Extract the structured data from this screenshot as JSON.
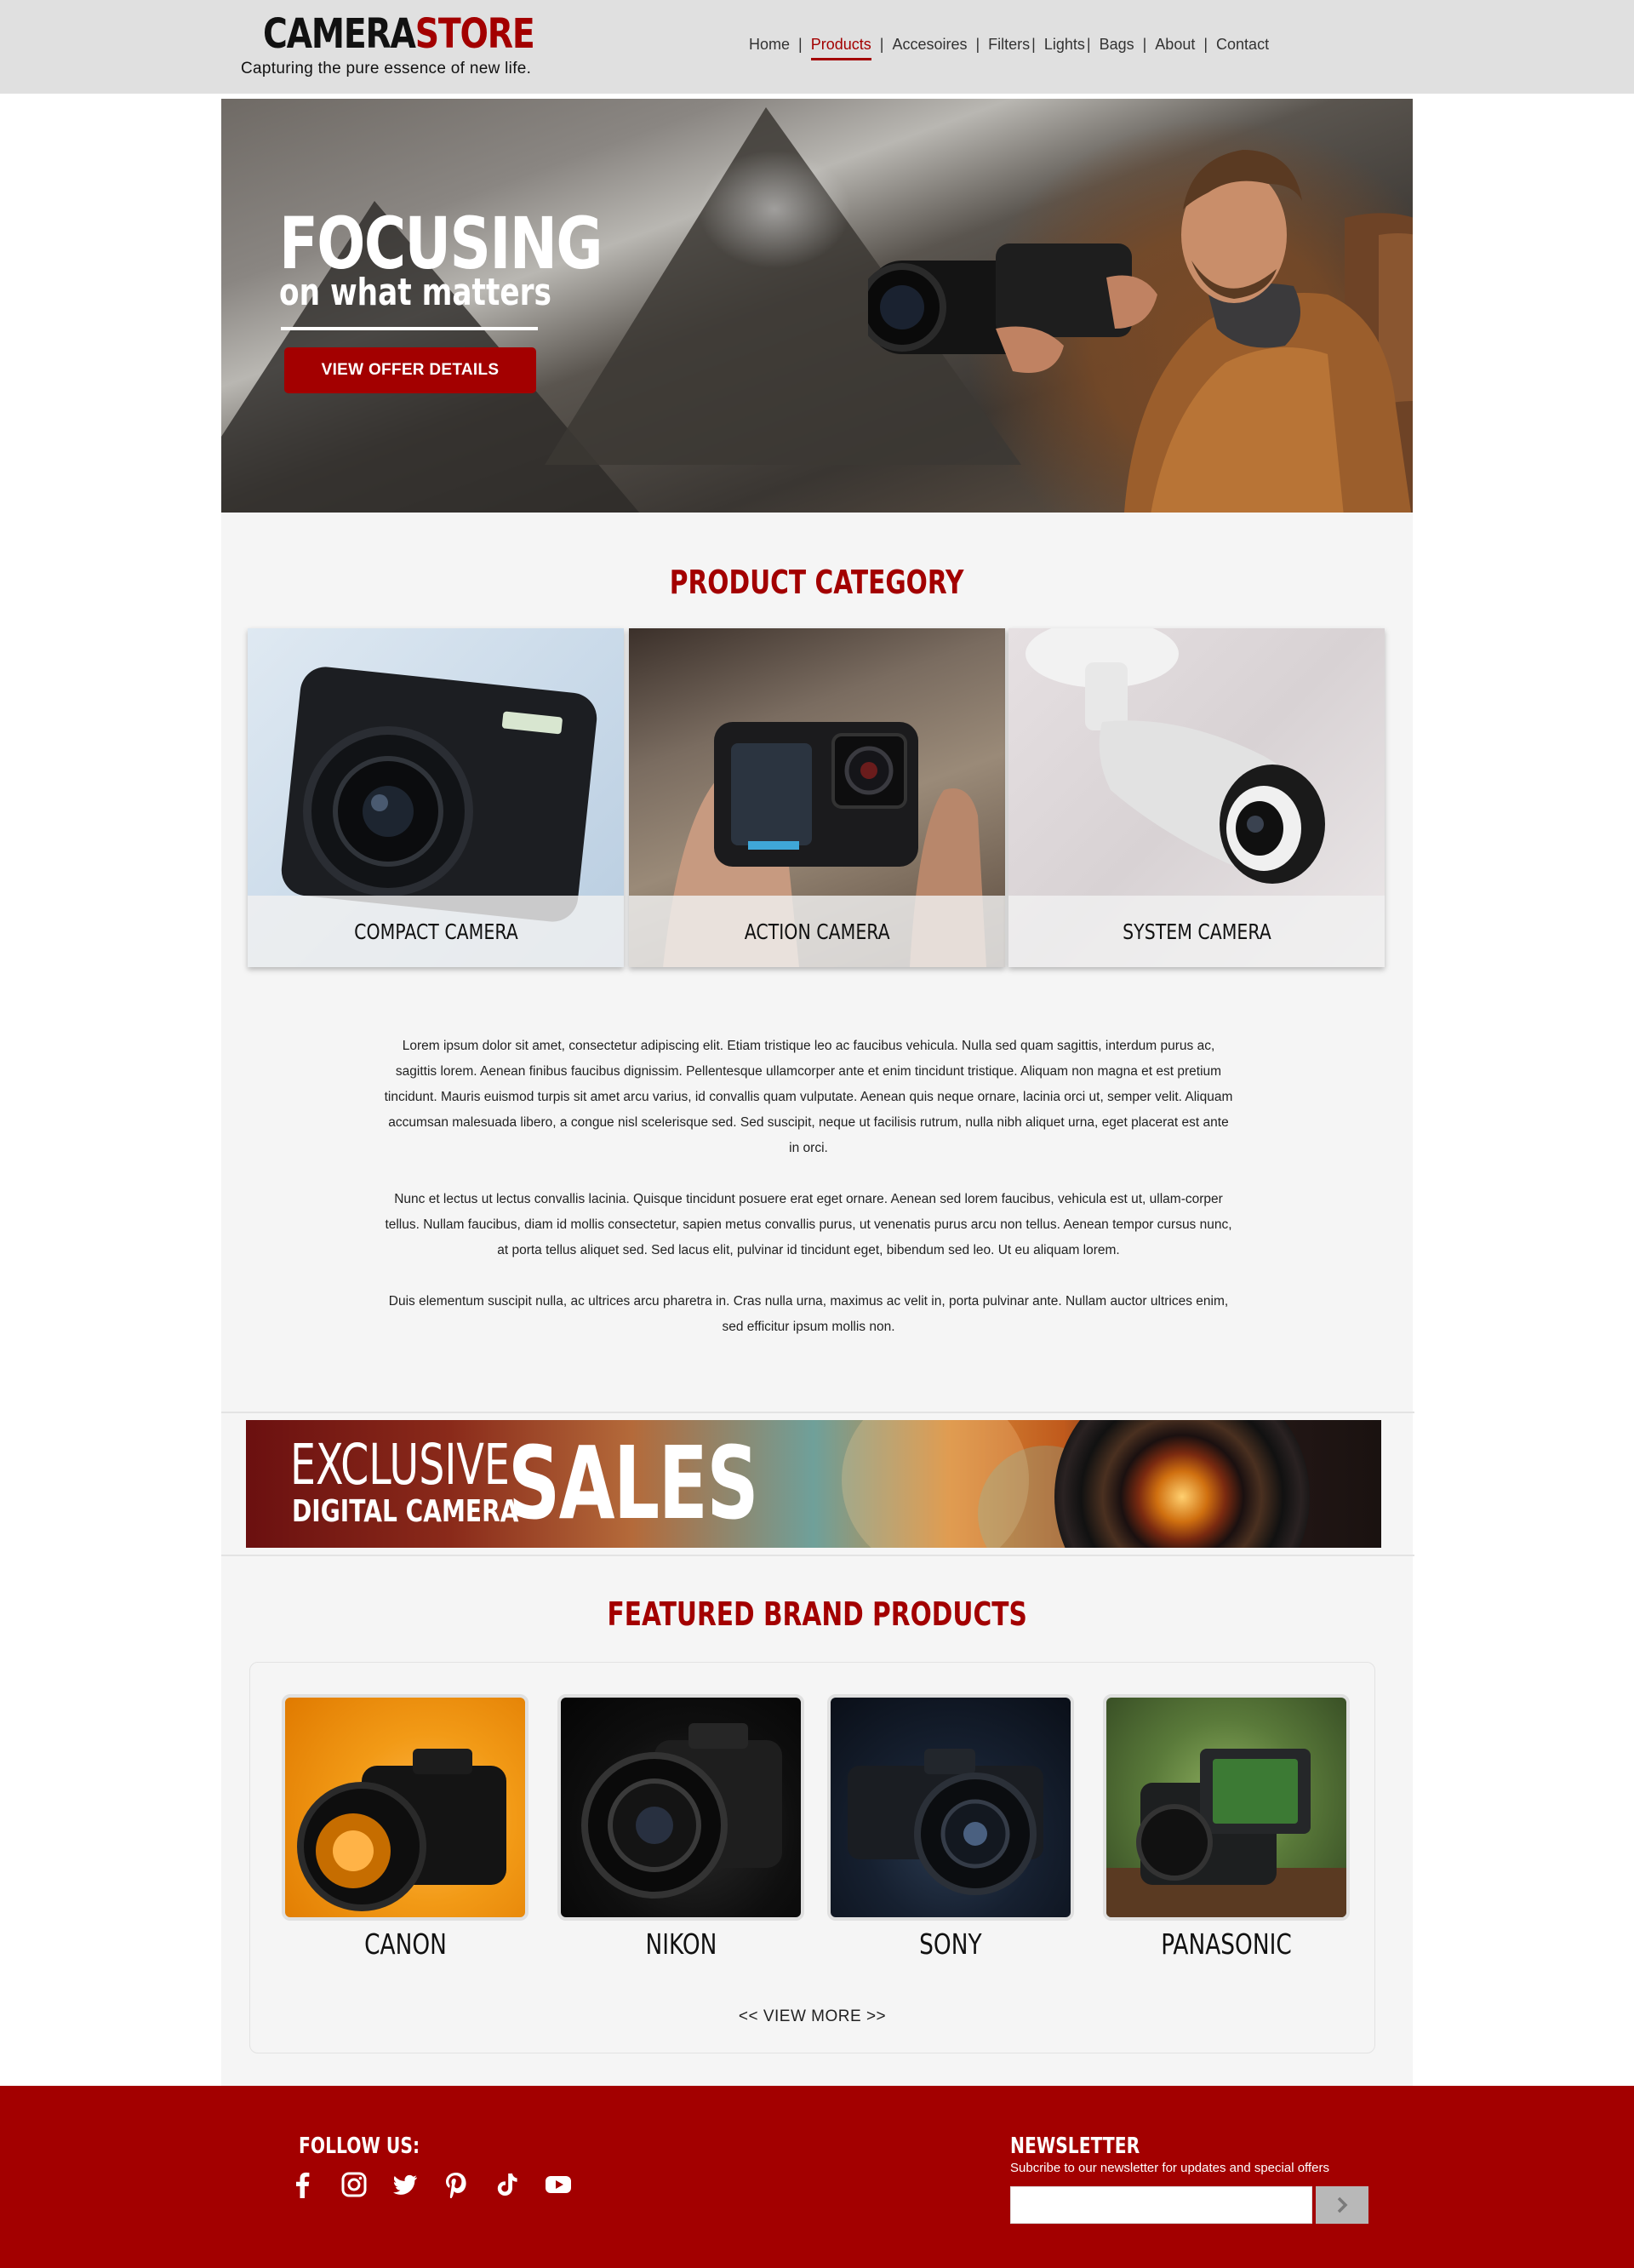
{
  "header": {
    "logo_part1": "CAMERA",
    "logo_part2": "STORE",
    "tagline": "Capturing the pure essence of new life.",
    "nav": [
      {
        "label": "Home"
      },
      {
        "label": "Products",
        "active": true
      },
      {
        "label": "Accesoires"
      },
      {
        "label": "Filters"
      },
      {
        "label": "Lights"
      },
      {
        "label": "Bags"
      },
      {
        "label": "About"
      },
      {
        "label": "Contact"
      }
    ]
  },
  "hero": {
    "headline": "FOCUSING",
    "subheadline": "on what matters",
    "cta_label": "VIEW OFFER DETAILS"
  },
  "categories": {
    "title": "PRODUCT CATEGORY",
    "items": [
      {
        "label": "COMPACT CAMERA"
      },
      {
        "label": "ACTION CAMERA"
      },
      {
        "label": "SYSTEM CAMERA"
      }
    ]
  },
  "body_text": {
    "p1": "Lorem ipsum dolor sit amet, consectetur adipiscing elit. Etiam tristique leo ac faucibus vehicula. Nulla sed quam sagittis, interdum purus ac, sagittis lorem. Aenean finibus faucibus dignissim. Pellentesque ullamcorper ante et enim tincidunt tristique. Aliquam non magna et est pretium tincidunt. Mauris euismod turpis sit amet arcu varius, id convallis quam vulputate. Aenean quis neque ornare, lacinia orci ut, semper velit. Aliquam accumsan malesuada libero, a congue nisl scelerisque sed. Sed suscipit, neque ut facilisis rutrum, nulla nibh aliquet urna, eget placerat est ante in orci.",
    "p2": "Nunc et lectus ut lectus convallis lacinia. Quisque tincidunt posuere erat eget ornare. Aenean sed lorem faucibus, vehicula est ut, ullam-corper tellus. Nullam faucibus, diam id mollis consectetur, sapien metus convallis purus, ut venenatis purus arcu non tellus. Aenean tempor cursus nunc, at porta tellus aliquet sed. Sed lacus elit, pulvinar id tincidunt eget, bibendum sed leo. Ut eu aliquam lorem.",
    "p3": "Duis elementum suscipit nulla, ac ultrices arcu pharetra in. Cras nulla urna, maximus ac velit in, porta pulvinar ante. Nullam auctor ultrices enim, sed efficitur ipsum mollis non."
  },
  "banner": {
    "line1": "EXCLUSIVE",
    "line2": "DIGITAL CAMERA",
    "line3": "SALES"
  },
  "featured": {
    "title": "FEATURED BRAND PRODUCTS",
    "brands": [
      {
        "label": "CANON"
      },
      {
        "label": "NIKON"
      },
      {
        "label": "SONY"
      },
      {
        "label": "PANASONIC"
      }
    ],
    "view_more": "<< VIEW MORE >>"
  },
  "footer": {
    "follow_label": "FOLLOW US:",
    "socials": [
      "facebook-icon",
      "instagram-icon",
      "twitter-icon",
      "pinterest-icon",
      "tiktok-icon",
      "youtube-icon"
    ],
    "newsletter_title": "NEWSLETTER",
    "newsletter_sub": "Subcribe to our newsletter for updates and special offers",
    "newsletter_placeholder": ""
  },
  "colors": {
    "brand_red": "#a30000",
    "header_bg": "#e0e0e0",
    "content_bg": "#f5f5f5"
  }
}
